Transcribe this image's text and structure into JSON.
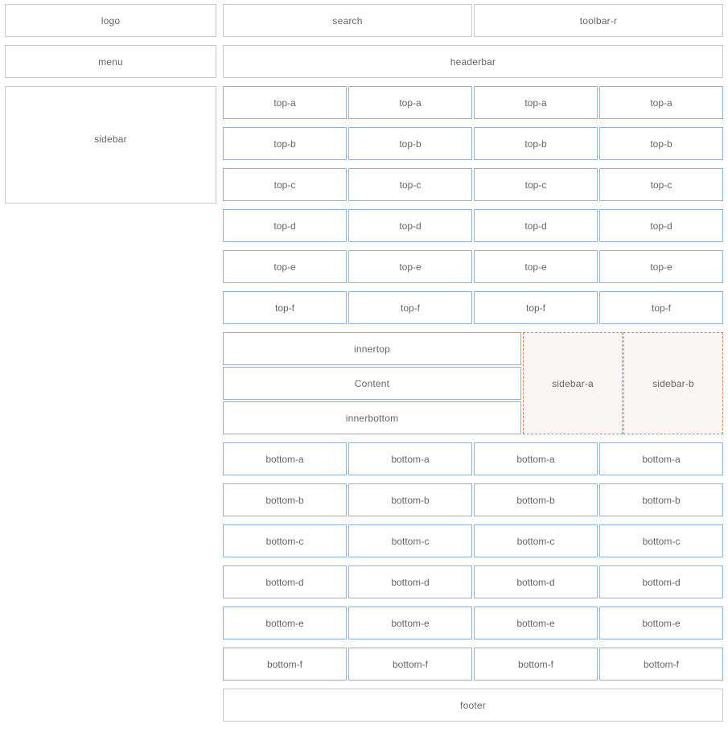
{
  "header": {
    "logo": "logo",
    "search": "search",
    "toolbar_r": "toolbar-r",
    "menu": "menu",
    "headerbar": "headerbar"
  },
  "sidebar": {
    "label": "sidebar"
  },
  "top_rows": [
    [
      "top-a",
      "top-a",
      "top-a",
      "top-a"
    ],
    [
      "top-b",
      "top-b",
      "top-b",
      "top-b"
    ],
    [
      "top-c",
      "top-c",
      "top-c",
      "top-c"
    ],
    [
      "top-d",
      "top-d",
      "top-d",
      "top-d"
    ],
    [
      "top-e",
      "top-e",
      "top-e",
      "top-e"
    ],
    [
      "top-f",
      "top-f",
      "top-f",
      "top-f"
    ]
  ],
  "middle": {
    "innertop": "innertop",
    "content": "Content",
    "innerbottom": "innerbottom",
    "sidebar_a": "sidebar-a",
    "sidebar_b": "sidebar-b"
  },
  "bottom_rows": [
    [
      "bottom-a",
      "bottom-a",
      "bottom-a",
      "bottom-a"
    ],
    [
      "bottom-b",
      "bottom-b",
      "bottom-b",
      "bottom-b"
    ],
    [
      "bottom-c",
      "bottom-c",
      "bottom-c",
      "bottom-c"
    ],
    [
      "bottom-d",
      "bottom-d",
      "bottom-d",
      "bottom-d"
    ],
    [
      "bottom-e",
      "bottom-e",
      "bottom-e",
      "bottom-e"
    ],
    [
      "bottom-f",
      "bottom-f",
      "bottom-f",
      "bottom-f"
    ]
  ],
  "footer": {
    "label": "footer"
  },
  "colors": {
    "gray_border": "#c9c9c9",
    "blue_border": "#8fb4d6",
    "dashed_border": "#e07b5a",
    "dashed_fill": "#f9f6f3",
    "text": "#666666"
  }
}
